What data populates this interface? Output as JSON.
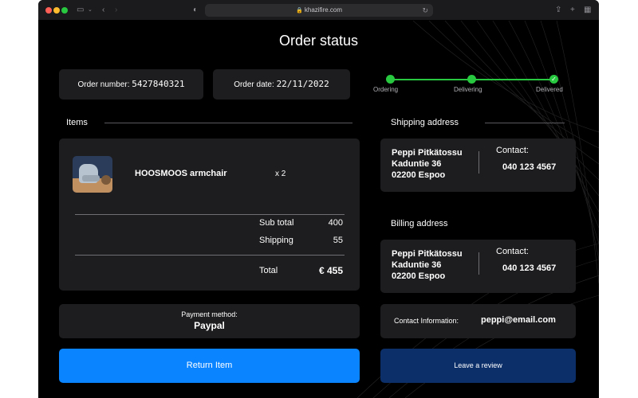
{
  "browser": {
    "url": "khazifire.com",
    "lock_icon": "lock-icon",
    "colors": {
      "close": "#ff5f57",
      "minimize": "#febc2e",
      "maximize": "#28c840"
    }
  },
  "page": {
    "title": "Order status",
    "order_number": {
      "label": "Order number:",
      "value": "5427840321"
    },
    "order_date": {
      "label": "Order date:",
      "value": "22/11/2022"
    },
    "progress": {
      "steps": [
        {
          "label": "Ordering",
          "done": true
        },
        {
          "label": "Delivering",
          "done": true
        },
        {
          "label": "Delivered",
          "done": true
        }
      ],
      "color": "#28c840"
    },
    "items": {
      "heading": "Items",
      "list": [
        {
          "name": "HOOSMOOS armchair",
          "qty": "x 2",
          "image": "armchair-image"
        }
      ],
      "subtotal_label": "Sub total",
      "subtotal_value": "400",
      "shipping_label": "Shipping",
      "shipping_value": "55",
      "total_label": "Total",
      "total_value": "€ 455"
    },
    "payment": {
      "label": "Payment method:",
      "value": "Paypal"
    },
    "shipping_address": {
      "heading": "Shipping address",
      "name": "Peppi Pitkätossu",
      "street": "Kaduntie 36",
      "city": "02200 Espoo",
      "contact_label": "Contact:",
      "phone": "040 123 4567"
    },
    "billing_address": {
      "heading": "Billing address",
      "name": "Peppi Pitkätossu",
      "street": "Kaduntie 36",
      "city": "02200 Espoo",
      "contact_label": "Contact:",
      "phone": "040 123 4567"
    },
    "contact_info": {
      "label": "Contact Information:",
      "value": "peppi@email.com"
    },
    "buttons": {
      "return_item": "Return Item",
      "leave_review": "Leave a review"
    },
    "colors": {
      "primary": "#0a84ff",
      "secondary": "#0c2f6a",
      "card": "#1d1d1f"
    }
  }
}
